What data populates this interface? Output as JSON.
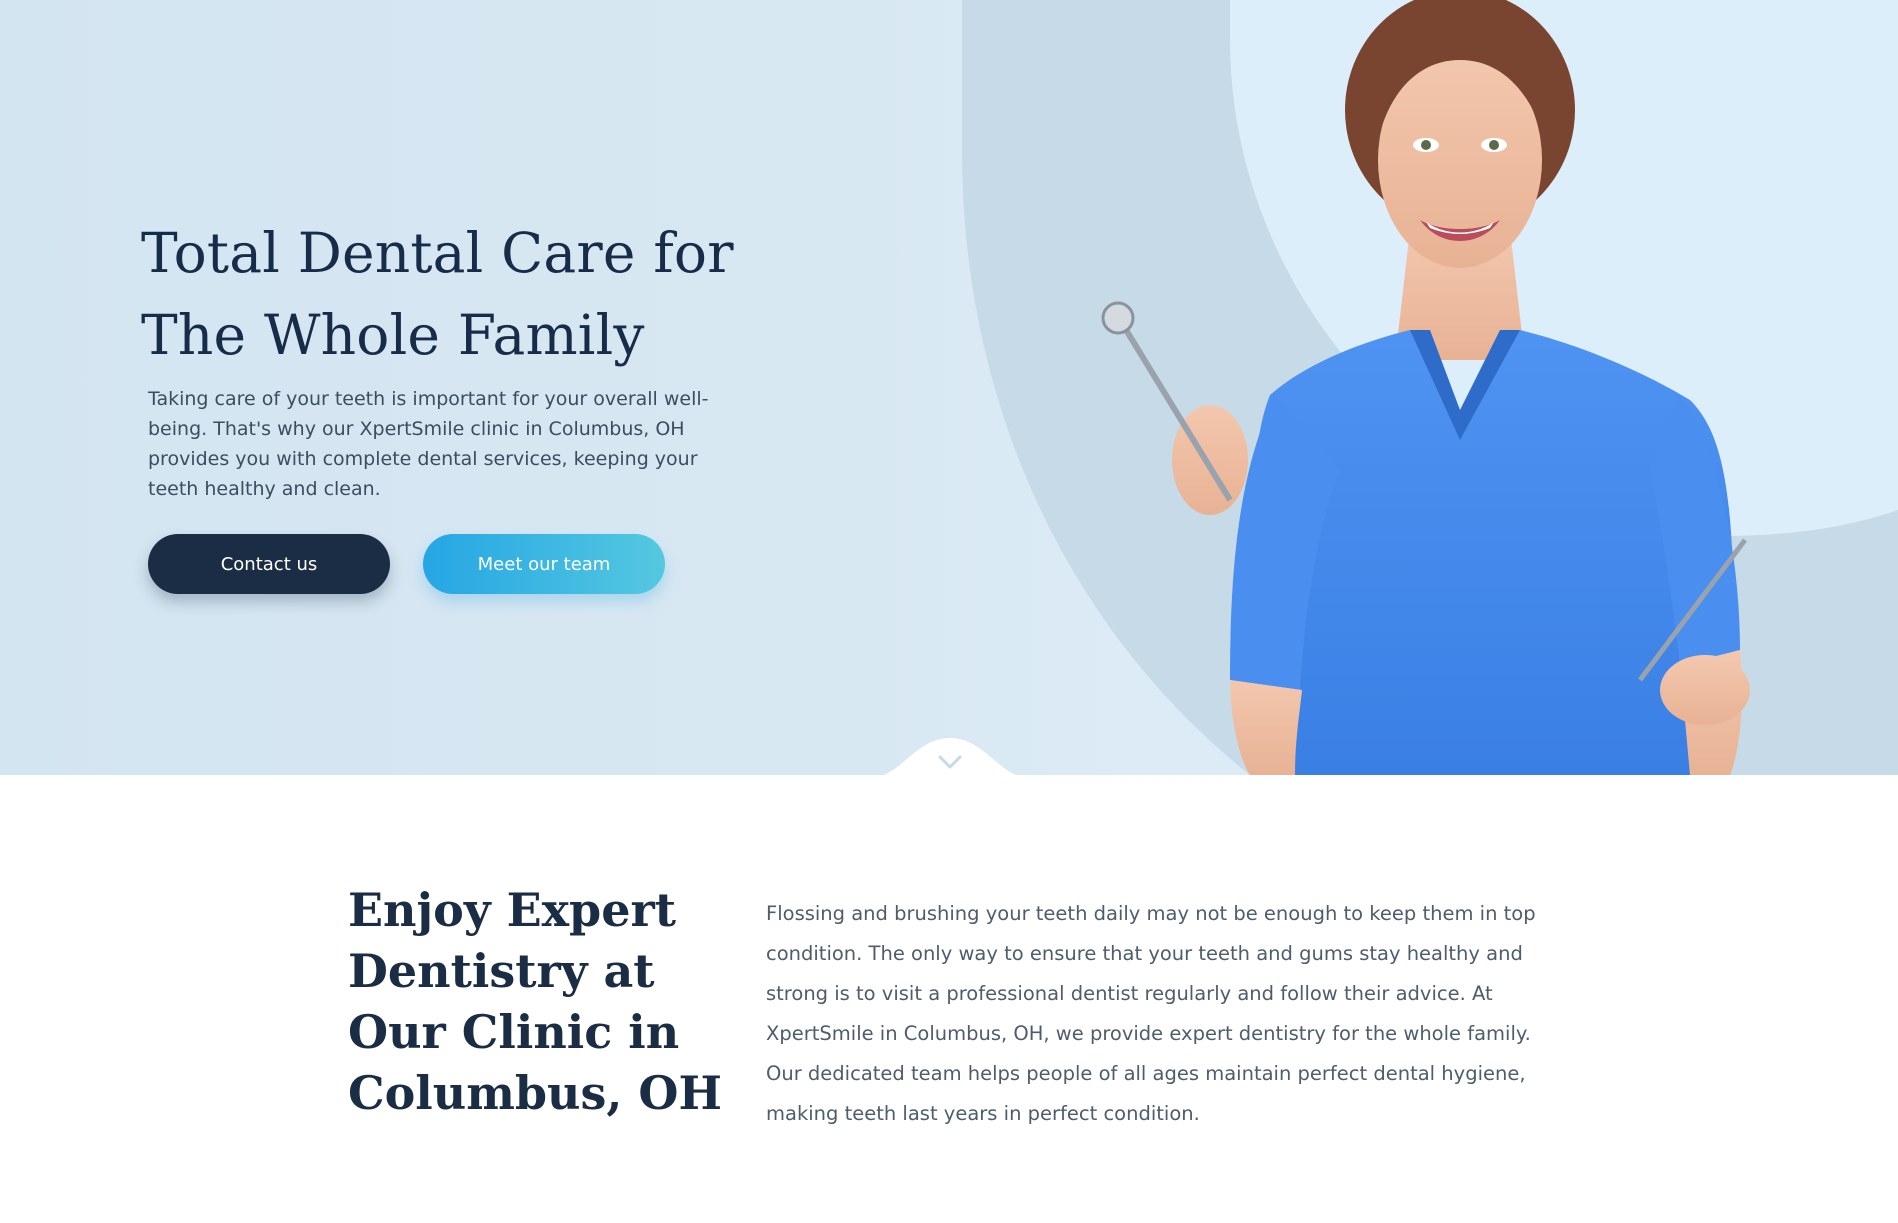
{
  "hero": {
    "title": "Total Dental Care for The Whole Family",
    "description": "Taking care of your teeth is important for your overall well-being. That's why our XpertSmile clinic in Columbus, OH provides you with complete dental services, keeping your teeth healthy and clean.",
    "buttons": {
      "contact_label": "Contact us",
      "team_label": "Meet our team"
    },
    "image_alt": "dentist-holding-dental-tools",
    "scroll_icon": "chevron-down-icon"
  },
  "intro": {
    "title": "Enjoy Expert Dentistry at Our Clinic in Columbus, OH",
    "text": "Flossing and brushing your teeth daily may not be enough to keep them in top condition. The only way to ensure that your teeth and gums stay healthy and strong is to visit a professional dentist regularly and follow their advice. At XpertSmile in Columbus, OH, we provide expert dentistry for the whole family. Our dedicated team helps people of all ages maintain perfect dental hygiene, making teeth last years in perfect condition."
  },
  "colors": {
    "hero_bg": "#d8e8f3",
    "navy": "#1b2d45",
    "accent_blue": "#25a6e4",
    "scrub_blue": "#4a8ff0"
  }
}
